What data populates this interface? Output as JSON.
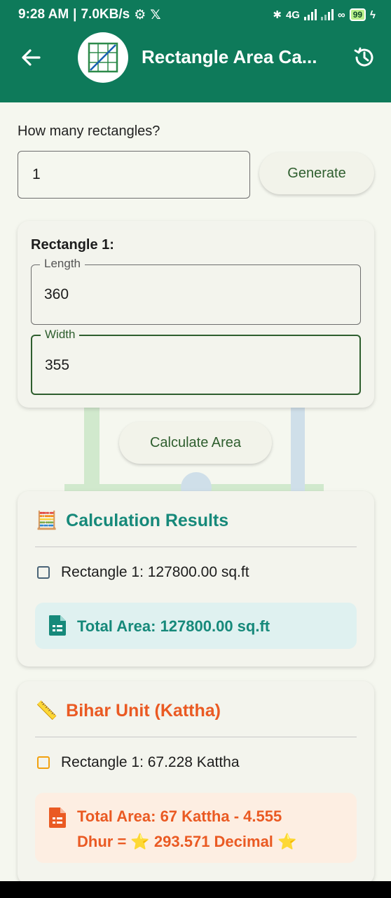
{
  "status": {
    "time": "9:28 AM",
    "speed": "7.0KB/s",
    "battery": "99",
    "net_label": "4G"
  },
  "appbar": {
    "title": "Rectangle Area Ca..."
  },
  "form": {
    "question": "How many rectangles?",
    "count_value": "1",
    "generate_label": "Generate"
  },
  "rectangle": {
    "title": "Rectangle 1:",
    "length_label": "Length",
    "length_value": "360",
    "width_label": "Width",
    "width_value": "355"
  },
  "calculate_label": "Calculate Area",
  "results": {
    "emoji": "🧮",
    "title": "Calculation Results",
    "item": "Rectangle 1: 127800.00 sq.ft",
    "total": "Total Area: 127800.00 sq.ft",
    "color": "#16897a"
  },
  "bihar": {
    "emoji": "📏",
    "title": "Bihar Unit (Kattha)",
    "item": "Rectangle 1: 67.228 Kattha",
    "total_line1": "Total Area: 67 Kattha - 4.555",
    "total_line2": "Dhur  =  ⭐ 293.571 Decimal ⭐",
    "color": "#ea5a23"
  }
}
